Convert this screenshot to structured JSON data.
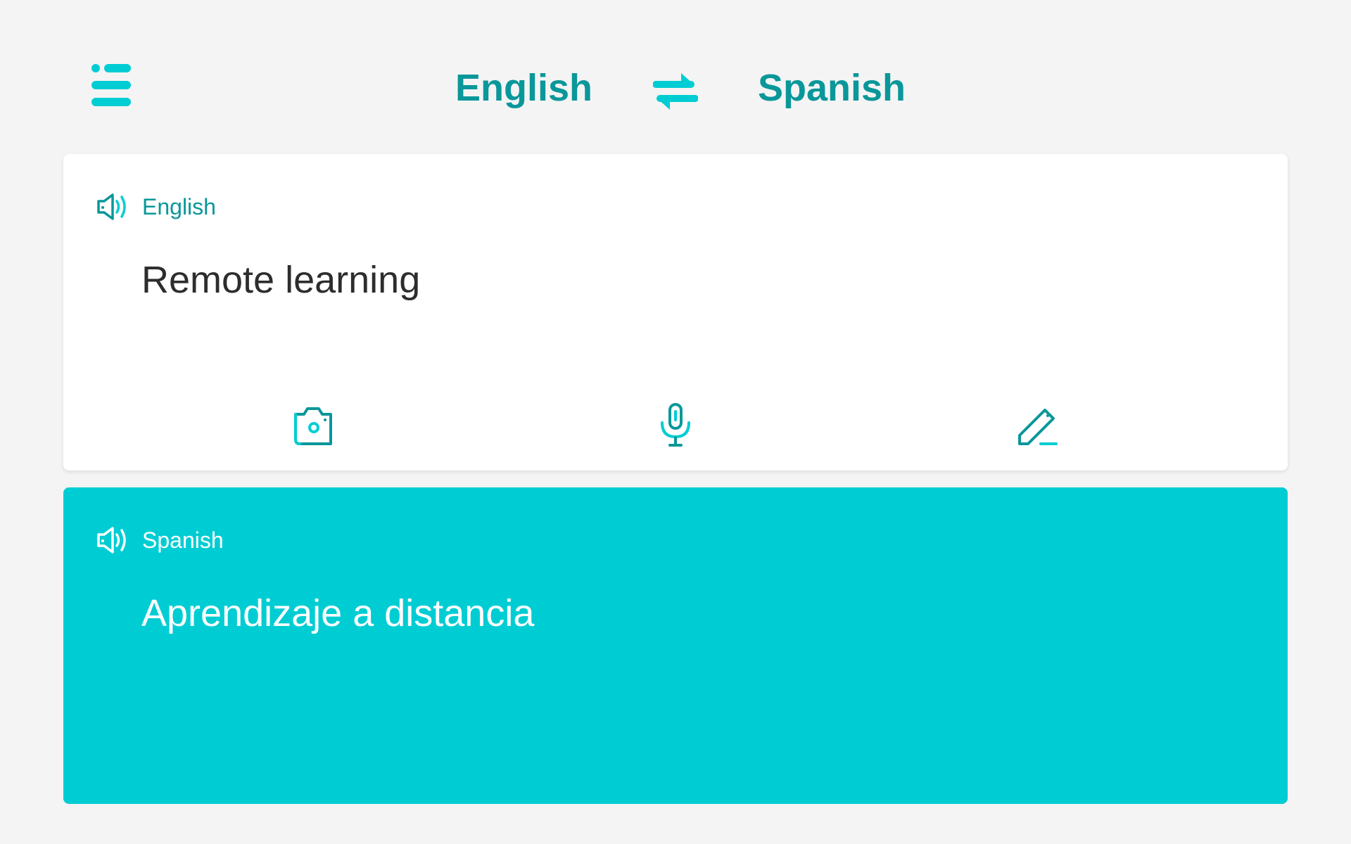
{
  "header": {
    "menu_icon": "hamburger-menu-icon",
    "source_language": "English",
    "target_language": "Spanish",
    "swap_icon": "swap-arrows-icon"
  },
  "source_panel": {
    "speaker_icon": "speaker-icon",
    "language_label": "English",
    "text": "Remote learning",
    "tools": [
      {
        "icon": "camera-icon"
      },
      {
        "icon": "microphone-icon"
      },
      {
        "icon": "pencil-icon"
      }
    ]
  },
  "target_panel": {
    "speaker_icon": "speaker-icon",
    "language_label": "Spanish",
    "text": "Aprendizaje a distancia"
  },
  "colors": {
    "accent": "#00cdd3",
    "accent_dark": "#0a979a",
    "background": "#f4f4f4",
    "card": "#ffffff",
    "text": "#2d2d2d"
  }
}
